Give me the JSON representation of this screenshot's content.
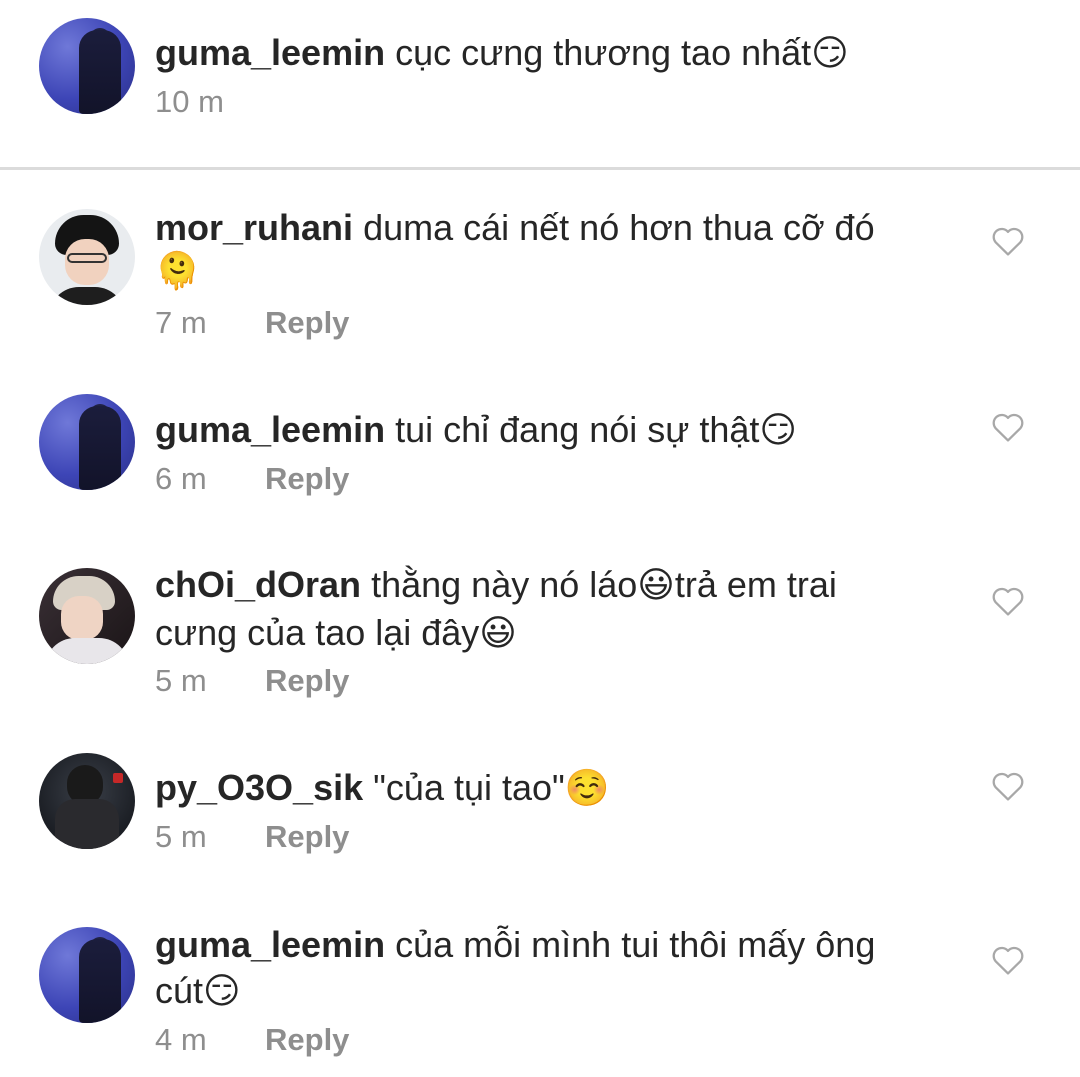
{
  "caption": {
    "username": "guma_leemin",
    "text": "cục cưng thương tao nhất",
    "emoji": "😏",
    "time": "10 m"
  },
  "comments": [
    {
      "username": "mor_ruhani",
      "text_line1": "duma cái nết nó hơn thua cỡ đó",
      "text_line2": "🫠",
      "time": "7 m",
      "reply_label": "Reply",
      "avatar_icon": "user-photo-icon",
      "like_icon": "heart-outline-icon"
    },
    {
      "username": "guma_leemin",
      "text_line1": "tui chỉ đang nói sự thật😏",
      "time": "6 m",
      "reply_label": "Reply",
      "avatar_icon": "user-photo-icon",
      "like_icon": "heart-outline-icon"
    },
    {
      "username": "chOi_dOran",
      "text_line1": "thằng này nó láo😃trả em trai",
      "text_line2": "cưng của tao lại đây😃",
      "time": "5 m",
      "reply_label": "Reply",
      "avatar_icon": "user-photo-icon",
      "like_icon": "heart-outline-icon"
    },
    {
      "username": "py_O3O_sik",
      "text_line1": "\"của tụi tao\"☺️",
      "time": "5 m",
      "reply_label": "Reply",
      "avatar_icon": "user-photo-icon",
      "like_icon": "heart-outline-icon"
    },
    {
      "username": "guma_leemin",
      "text_line1": "của mỗi mình tui thôi mấy ông",
      "text_line2": "cút😏",
      "time": "4 m",
      "reply_label": "Reply",
      "avatar_icon": "user-photo-icon",
      "like_icon": "heart-outline-icon"
    }
  ],
  "colors": {
    "text": "#262626",
    "muted": "#8e8e8e",
    "divider": "#dbdbdb",
    "heart": "#a8a8a8"
  }
}
